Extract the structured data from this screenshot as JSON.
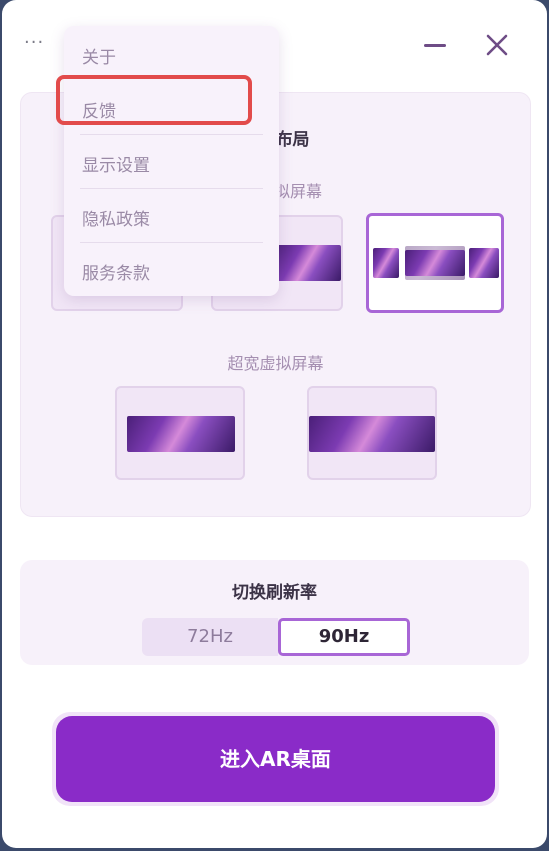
{
  "titlebar": {
    "more_label": "···"
  },
  "layout_panel": {
    "title": "屏幕布局",
    "virtual_title": "拟屏幕",
    "ultrawide_title": "超宽虚拟屏幕"
  },
  "refresh_panel": {
    "title": "切换刷新率",
    "options": [
      "72Hz",
      "90Hz"
    ],
    "selected": "90Hz"
  },
  "enter_button": {
    "label": "进入AR桌面"
  },
  "menu": {
    "items": [
      "关于",
      "反馈",
      "显示设置",
      "隐私政策",
      "服务条款"
    ],
    "highlighted": "反馈"
  },
  "colors": {
    "accent": "#a866d6",
    "primary_button": "#8a2bc8",
    "highlight_box": "#e24b4b",
    "panel_bg": "#f7f1fa"
  }
}
